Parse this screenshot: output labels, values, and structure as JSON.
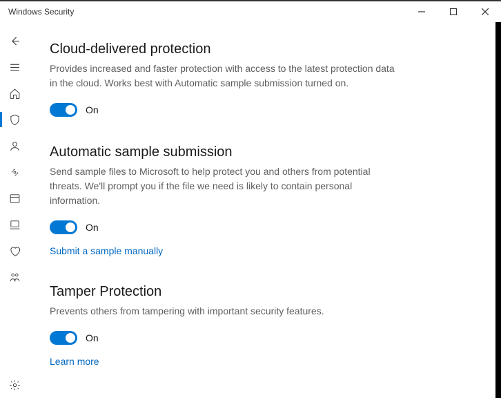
{
  "window": {
    "title": "Windows Security"
  },
  "sidebar": {
    "items": [
      {
        "name": "back",
        "icon": "back"
      },
      {
        "name": "menu",
        "icon": "menu"
      },
      {
        "name": "home",
        "icon": "home"
      },
      {
        "name": "shield",
        "icon": "shield",
        "selected": true
      },
      {
        "name": "account",
        "icon": "account"
      },
      {
        "name": "firewall",
        "icon": "firewall"
      },
      {
        "name": "appbrowser",
        "icon": "appbrowser"
      },
      {
        "name": "device",
        "icon": "device"
      },
      {
        "name": "health",
        "icon": "health"
      },
      {
        "name": "family",
        "icon": "family"
      }
    ],
    "settings_icon": "settings"
  },
  "sections": [
    {
      "heading": "Cloud-delivered protection",
      "description": "Provides increased and faster protection with access to the latest protection data in the cloud. Works best with Automatic sample submission turned on.",
      "toggle_state": "On"
    },
    {
      "heading": "Automatic sample submission",
      "description": "Send sample files to Microsoft to help protect you and others from potential threats. We'll prompt you if the file we need is likely to contain personal information.",
      "toggle_state": "On",
      "link": "Submit a sample manually"
    },
    {
      "heading": "Tamper Protection",
      "description": "Prevents others from tampering with important security features.",
      "toggle_state": "On",
      "link": "Learn more"
    }
  ]
}
